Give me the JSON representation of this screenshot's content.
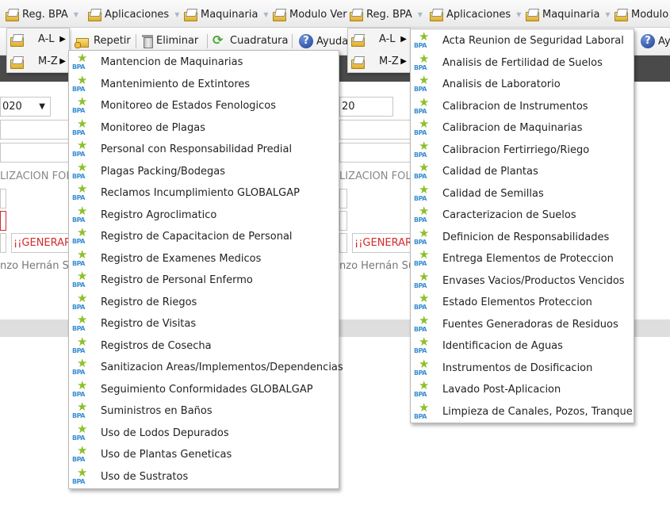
{
  "menubar": {
    "items": [
      {
        "label": "Reg. BPA"
      },
      {
        "label": "Aplicaciones"
      },
      {
        "label": "Maquinaria"
      },
      {
        "label": "Modulo Ver"
      },
      {
        "label": "Reg. BPA"
      },
      {
        "label": "Aplicaciones"
      },
      {
        "label": "Maquinaria"
      },
      {
        "label": "Modulo"
      }
    ]
  },
  "toolbar": {
    "repetir": "Repetir",
    "eliminar": "Eliminar",
    "cuadratura": "Cuadratura",
    "ayuda_left": "Ayuda",
    "ayuda_right": "Ay"
  },
  "az": {
    "al": "A-L",
    "mz": "M-Z"
  },
  "background": {
    "year_left": "020",
    "year_right": "20",
    "section_left": "LIZACION FOL",
    "section_right": "LIZACION FOL",
    "generar_left": "¡¡GENERAR",
    "generar_right": "¡¡GENERAR",
    "person_left": "nzo Hernán Su",
    "person_right": "nzo Hernán Su"
  },
  "menu_left": {
    "items": [
      "Mantencion de Maquinarias",
      "Mantenimiento de Extintores",
      "Monitoreo de Estados Fenologicos",
      "Monitoreo de Plagas",
      "Personal con Responsabilidad Predial",
      "Plagas Packing/Bodegas",
      "Reclamos Incumplimiento GLOBALGAP",
      "Registro Agroclimatico",
      "Registro de Capacitacion de Personal",
      "Registro de Examenes Medicos",
      "Registro de Personal Enfermo",
      "Registro de Riegos",
      "Registro de Visitas",
      "Registros de Cosecha",
      "Sanitizacion Areas/Implementos/Dependencias",
      "Seguimiento Conformidades GLOBALGAP",
      "Suministros en Baños",
      "Uso de Lodos Depurados",
      "Uso de Plantas Geneticas",
      "Uso de Sustratos"
    ]
  },
  "menu_right": {
    "items": [
      "Acta Reunion de Seguridad Laboral",
      "Analisis de Fertilidad de Suelos",
      "Analisis de Laboratorio",
      "Calibracion de Instrumentos",
      "Calibracion de Maquinarias",
      "Calibracion Fertirriego/Riego",
      "Calidad de Plantas",
      "Calidad de Semillas",
      "Caracterizacion de Suelos",
      "Definicion de Responsabilidades",
      "Entrega Elementos de Proteccion",
      "Envases Vacios/Productos Vencidos",
      "Estado Elementos Proteccion",
      "Fuentes Generadoras de Residuos",
      "Identificacion de Aguas",
      "Instrumentos de Dosificacion",
      "Lavado Post-Aplicacion",
      "Limpieza de Canales, Pozos, Tranque"
    ]
  },
  "icons": {
    "bpa_logo_text": "BPA"
  },
  "colors": {
    "darkbar": "#4a4a4a",
    "generar": "#d42a2a",
    "bpa_blue": "#3c8fd2",
    "bpa_green": "#8dbf2c"
  }
}
